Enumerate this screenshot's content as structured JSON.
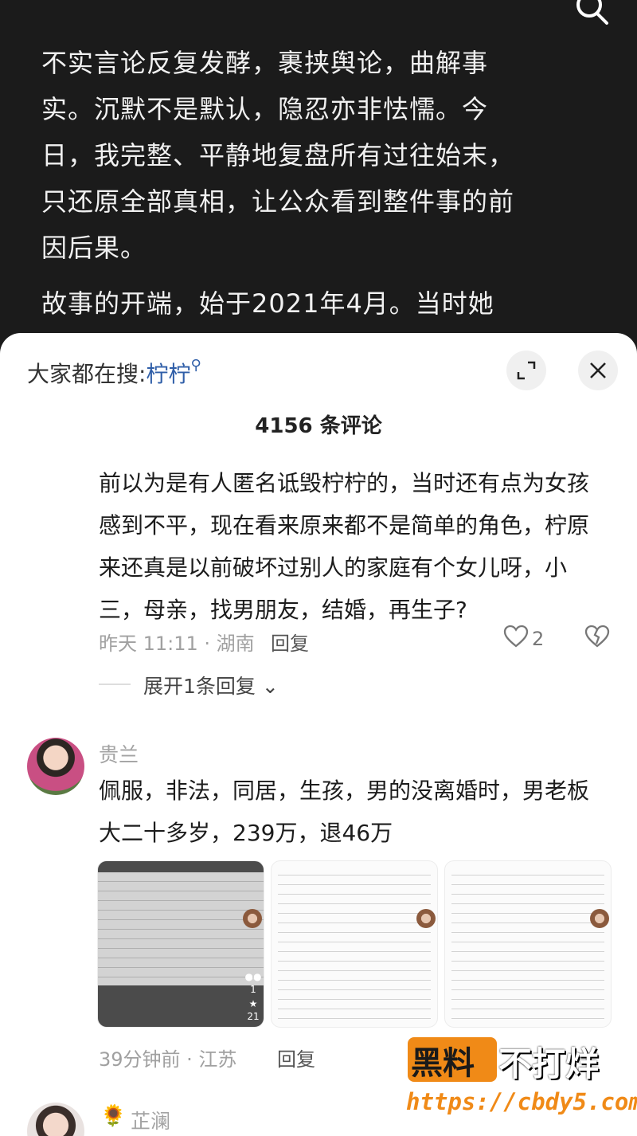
{
  "article": {
    "paragraph1": "不实言论反复发酵，裹挟舆论，曲解事实。沉默不是默认，隐忍亦非怯懦。今日，我完整、平静地复盘所有过往始末，只还原全部真相，让公众看到整件事的前因后果。",
    "paragraph2": "故事的开端，始于2021年4月。当时她"
  },
  "sheet": {
    "search_prefix": "大家都在搜:",
    "search_keyword": "柠柠",
    "comment_count": "4156 条评论"
  },
  "comments": [
    {
      "text": "前以为是有人匿名诋毁柠柠的，当时还有点为女孩感到不平，现在看来原来都不是简单的角色，柠原来还真是以前破坏过别人的家庭有个女儿呀，小三，母亲，找男朋友，结婚，再生子?",
      "meta": "昨天 11:11 · 湖南",
      "reply_label": "回复",
      "likes": "2",
      "expand_label": "展开1条回复"
    },
    {
      "username": "贵兰",
      "text": "佩服，非法，同居，生孩，男的没离婚时，男老板大二十多岁，239万，退46万",
      "meta": "39分钟前 · 江苏",
      "reply_label": "回复",
      "thumb1_count_a": "1",
      "thumb1_count_b": "21"
    },
    {
      "username": "芷澜"
    }
  ],
  "watermark": {
    "brand_left": "黑料",
    "brand_right": "不打烊",
    "url": "https://cbdy5.com"
  },
  "colors": {
    "article_bg": "#1b1b1b",
    "keyword": "#2f5ea8",
    "watermark_orange": "#f08a17"
  }
}
